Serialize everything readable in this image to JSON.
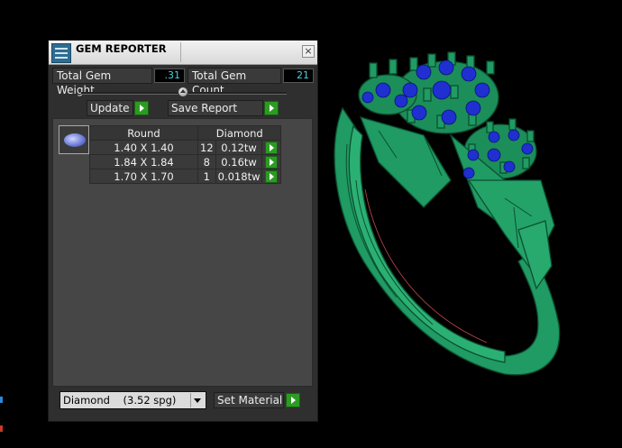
{
  "panel": {
    "title": "GEM REPORTER",
    "close_glyph": "×",
    "total_weight_label": "Total Gem Weight",
    "total_weight_value": ".31",
    "total_count_label": "Total Gem Count",
    "total_count_value": "21",
    "update_label": "Update",
    "save_report_label": "Save Report",
    "material_select": "Diamond    (3.52 spg)",
    "set_material_label": "Set Material"
  },
  "gem_table": {
    "headers": [
      "Round",
      "Diamond"
    ],
    "rows": [
      {
        "size": "1.40 X 1.40",
        "count": "12",
        "weight": "0.12tw"
      },
      {
        "size": "1.84 X 1.84",
        "count": "8",
        "weight": "0.16tw"
      },
      {
        "size": "1.70 X 1.70",
        "count": "1",
        "weight": "0.018tw"
      }
    ]
  },
  "icons": {
    "app": "gem-reporter-icon",
    "close": "close-icon",
    "play": "play-arrow-icon",
    "gem": "oval-gem-icon",
    "dropdown": "chevron-down-icon"
  },
  "colors": {
    "ring_metal": "#1f9b63",
    "ring_wire": "#0f5e3a",
    "gems": "#1f2fd0",
    "button_green": "#2c9b22",
    "value_cyan": "#49d1e0"
  }
}
